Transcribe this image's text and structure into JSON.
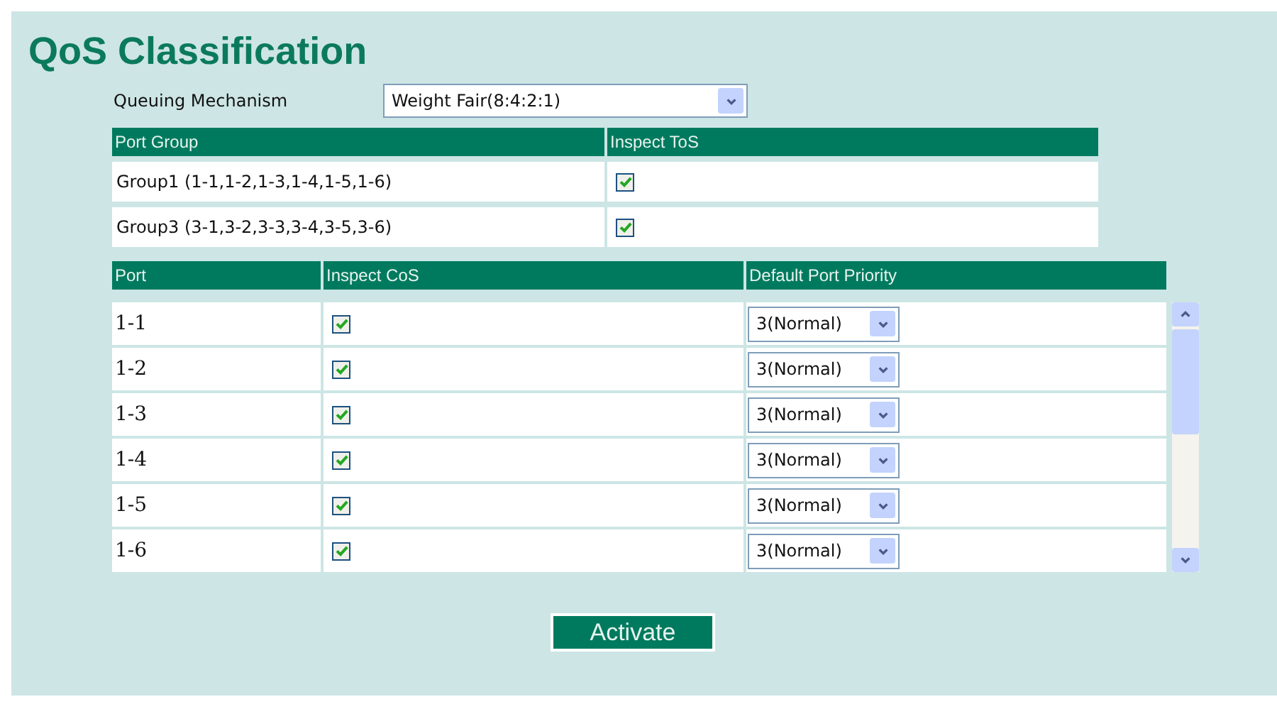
{
  "title": "QoS Classification",
  "queuing": {
    "label": "Queuing Mechanism",
    "value": "Weight Fair(8:4:2:1)"
  },
  "group_table": {
    "columns": [
      "Port Group",
      "Inspect ToS"
    ],
    "rows": [
      {
        "group": "Group1 (1-1,1-2,1-3,1-4,1-5,1-6)",
        "inspect_tos": true
      },
      {
        "group": "Group3 (3-1,3-2,3-3,3-4,3-5,3-6)",
        "inspect_tos": true
      }
    ]
  },
  "port_table": {
    "columns": [
      "Port",
      "Inspect CoS",
      "Default Port Priority"
    ],
    "rows": [
      {
        "port": "1-1",
        "inspect_cos": true,
        "priority": "3(Normal)"
      },
      {
        "port": "1-2",
        "inspect_cos": true,
        "priority": "3(Normal)"
      },
      {
        "port": "1-3",
        "inspect_cos": true,
        "priority": "3(Normal)"
      },
      {
        "port": "1-4",
        "inspect_cos": true,
        "priority": "3(Normal)"
      },
      {
        "port": "1-5",
        "inspect_cos": true,
        "priority": "3(Normal)"
      },
      {
        "port": "1-6",
        "inspect_cos": true,
        "priority": "3(Normal)"
      }
    ]
  },
  "buttons": [
    "Activate"
  ]
}
